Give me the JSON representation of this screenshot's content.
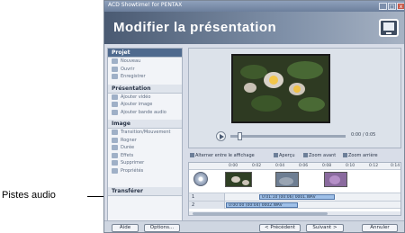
{
  "window": {
    "title": "ACD Showtime! for PENTAX",
    "controls": [
      "_",
      "□",
      "x"
    ]
  },
  "header": {
    "title": "Modifier la présentation",
    "icon": "monitor-icon"
  },
  "sidebar": {
    "sections": [
      {
        "title": "Projet",
        "active": true,
        "items": [
          "Nouveau",
          "Ouvrir",
          "Enregistrer"
        ]
      },
      {
        "title": "Présentation",
        "active": false,
        "items": [
          "Ajouter vidéo",
          "Ajouter image",
          "Ajouter bande audio"
        ]
      },
      {
        "title": "Image",
        "active": false,
        "items": [
          "Transition/Mouvement",
          "Rogner",
          "Durée",
          "Effets",
          "Supprimer",
          "Propriétés"
        ]
      },
      {
        "title": "Transférer",
        "active": false,
        "items": []
      }
    ]
  },
  "preview": {
    "time": "0:00 / 0:05",
    "playback_fraction": 0.08
  },
  "timeline_toolbar": {
    "toggle": "Alterner entre le affichage",
    "preview": "Aperçu",
    "zoom_in": "Zoom avant",
    "zoom_out": "Zoom arrière"
  },
  "timeline": {
    "ruler_ticks": [
      "0:00",
      "0:02",
      "0:04",
      "0:06",
      "0:08",
      "0:10",
      "0:12",
      "0:14"
    ],
    "tracks": [
      {
        "label": "1",
        "clip": "0:01:10 (00:06) 0001.WAV"
      },
      {
        "label": "2",
        "clip": "0:00:00 (00:04) 0002.WAV"
      }
    ]
  },
  "buttons": {
    "help": "Aide",
    "options": "Options...",
    "previous": "< Précédent",
    "next": "Suivant >",
    "cancel": "Annuler"
  },
  "callout": {
    "label": "Pistes audio"
  },
  "colors": {
    "header_start": "#4a5a72",
    "active_section": "#4f6a8e",
    "audio_clip": "#9fc0e8"
  }
}
